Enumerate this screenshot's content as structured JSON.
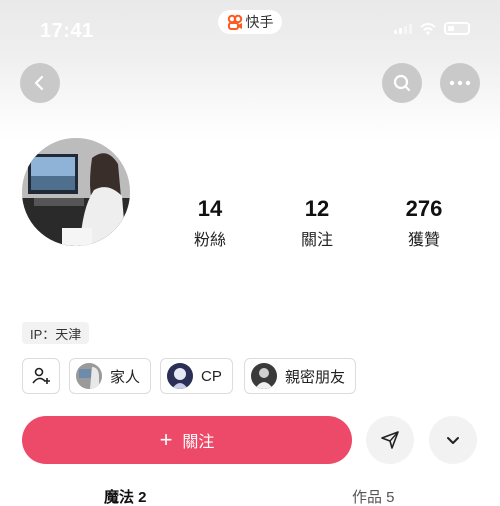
{
  "status_bar": {
    "time": "17:41",
    "app_name": "快手"
  },
  "profile": {
    "followers_count": "14",
    "followers_label": "粉絲",
    "following_count": "12",
    "following_label": "關注",
    "likes_count": "276",
    "likes_label": "獲贊",
    "ip_location": "IP：天津"
  },
  "chips": [
    {
      "label": "家人"
    },
    {
      "label": "CP"
    },
    {
      "label": "親密朋友"
    }
  ],
  "actions": {
    "follow_label": "關注",
    "follow_color": "#ec4a68"
  },
  "tabs": [
    {
      "label": "魔法 2",
      "active": true
    },
    {
      "label": "作品 5",
      "active": false
    }
  ]
}
